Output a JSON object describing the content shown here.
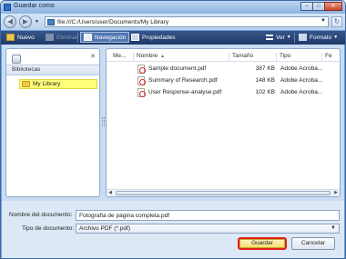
{
  "window": {
    "title": "Guardar como",
    "controls": [
      "–",
      "□",
      "✕"
    ]
  },
  "address": {
    "path": "file:///C:/Users/user/Documents/My Library"
  },
  "toolbar": {
    "nuevo": "Nuevo",
    "eliminar": "Eliminar",
    "navegacion": "Navegación",
    "propiedades": "Propiedades",
    "ver": "Ver",
    "formato": "Formato"
  },
  "sidebar": {
    "header": "Bibliotecas",
    "items": [
      {
        "label": "My Library",
        "selected": true
      }
    ]
  },
  "file_list": {
    "columns": [
      "Me...",
      "Nombre",
      "Tamaño",
      "Tipo",
      "Fe"
    ],
    "rows": [
      {
        "name": "Sample document.pdf",
        "size": "387 KB",
        "type": "Adobe Acroba..."
      },
      {
        "name": "Summary of Research.pdf",
        "size": "148 KB",
        "type": "Adobe Acroba..."
      },
      {
        "name": "User Response-analyse.pdf",
        "size": "102 KB",
        "type": "Adobe Acroba..."
      }
    ]
  },
  "form": {
    "filename_label": "Nombre del documento:",
    "filename_value": "Fotografía de página completa.pdf",
    "filetype_label": "Tipo de documento:",
    "filetype_value": "Archivo PDF (*.pdf)"
  },
  "buttons": {
    "save": "Guardar",
    "cancel": "Cancelar"
  },
  "colors": {
    "save_highlight": "#e3201d",
    "toolbar_bg": "#2a4778",
    "selection": "#ffff78"
  }
}
